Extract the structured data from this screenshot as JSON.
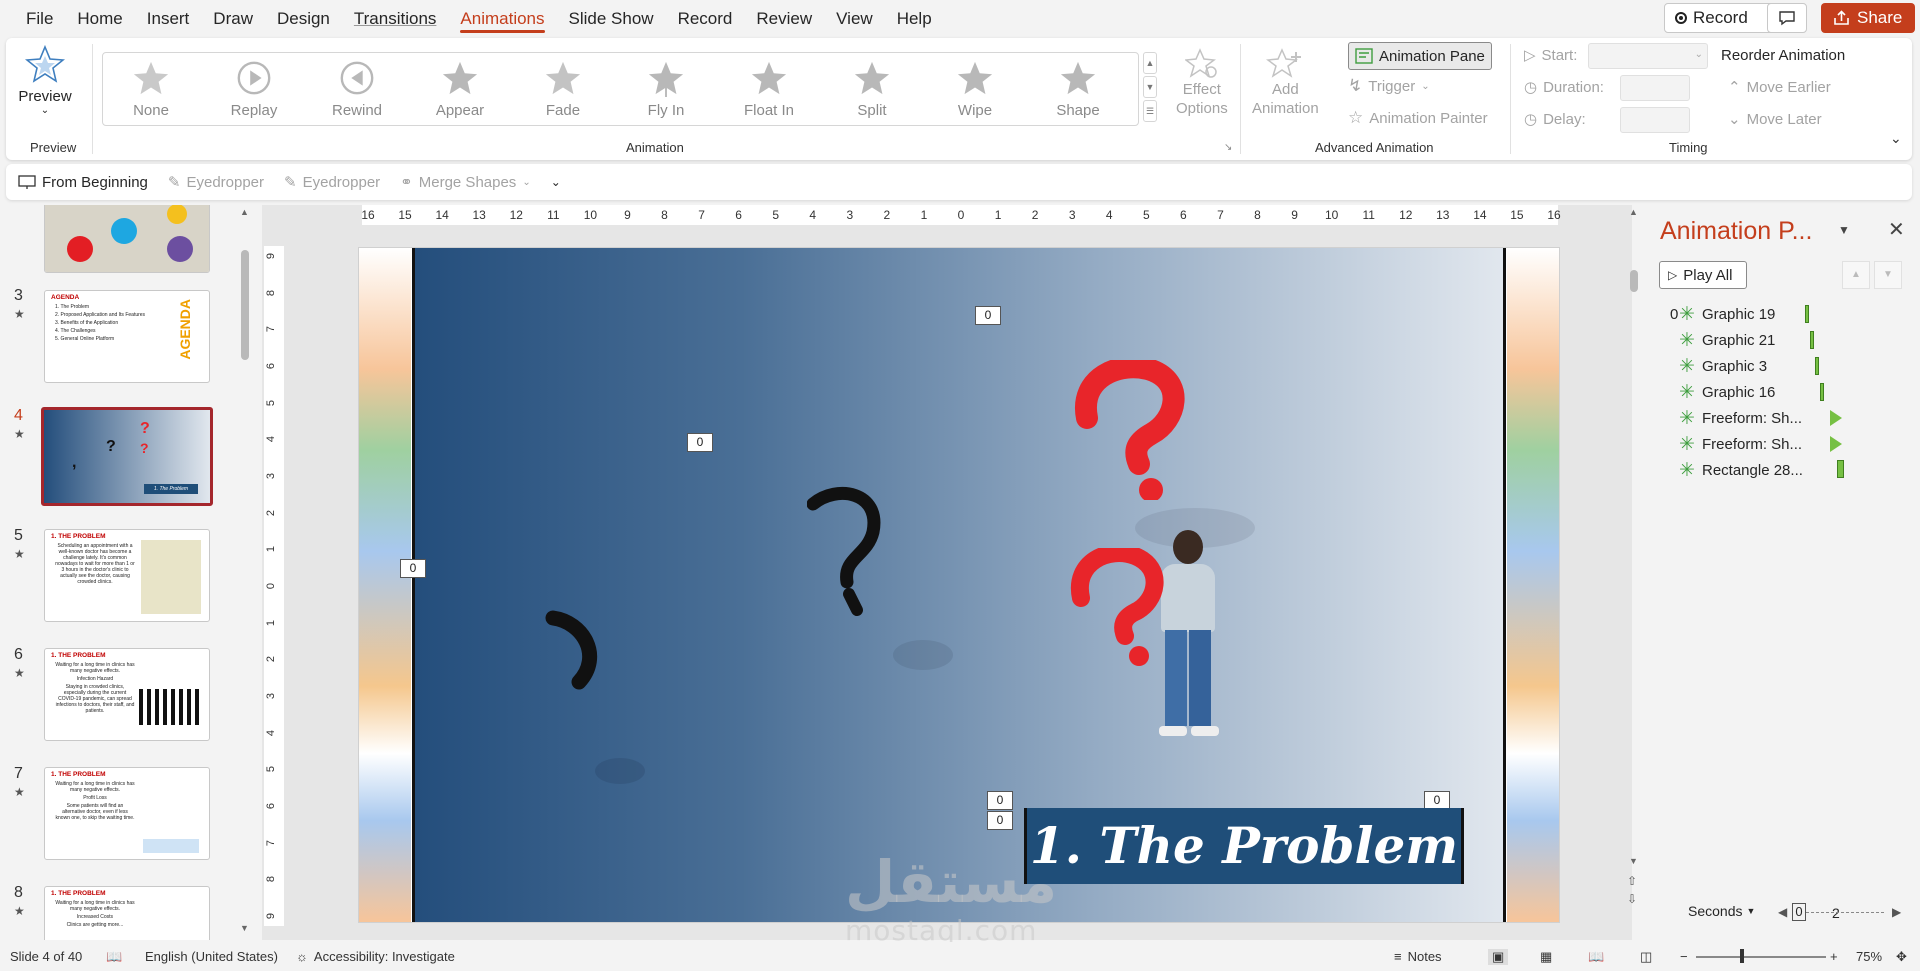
{
  "menu": {
    "tabs": [
      "File",
      "Home",
      "Insert",
      "Draw",
      "Design",
      "Transitions",
      "Animations",
      "Slide Show",
      "Record",
      "Review",
      "View",
      "Help"
    ],
    "active_index": 6,
    "record_label": "Record",
    "share_label": "Share"
  },
  "ribbon": {
    "preview_label": "Preview",
    "preview_group": "Preview",
    "animation_group": "Animation",
    "animations": [
      "None",
      "Replay",
      "Rewind",
      "Appear",
      "Fade",
      "Fly In",
      "Float In",
      "Split",
      "Wipe",
      "Shape"
    ],
    "effect_options_line1": "Effect",
    "effect_options_line2": "Options",
    "add_animation_line1": "Add",
    "add_animation_line2": "Animation",
    "animation_pane_label": "Animation Pane",
    "trigger_label": "Trigger",
    "animation_painter_label": "Animation Painter",
    "advanced_group": "Advanced Animation",
    "start_label": "Start:",
    "duration_label": "Duration:",
    "delay_label": "Delay:",
    "reorder_label": "Reorder Animation",
    "move_earlier_label": "Move Earlier",
    "move_later_label": "Move Later",
    "timing_group": "Timing"
  },
  "qat": {
    "from_beginning": "From Beginning",
    "eyedropper1": "Eyedropper",
    "eyedropper2": "Eyedropper",
    "merge_shapes": "Merge Shapes"
  },
  "thumbnails": [
    {
      "num": "3",
      "title": "AGENDA",
      "lines": [
        "1. The Problem",
        "2. Proposed Application and Its Features",
        "3. Benefits of the Application",
        "4. The Challenges",
        "5. General Online Platform"
      ],
      "side_text": "AGENDA"
    },
    {
      "num": "4",
      "selected": true,
      "caption": "1. The Problem"
    },
    {
      "num": "5",
      "title": "1. THE PROBLEM",
      "lines": [
        "Scheduling an appointment with a well-known doctor has become a challenge lately. It's common nowadays to wait for more than 1 or 3 hours in the doctor's clinic to actually see the doctor, causing crowded clinics."
      ]
    },
    {
      "num": "6",
      "title": "1. THE PROBLEM",
      "lines": [
        "Waiting for a long time in clinics has many negative effects.",
        "Infection Hazard",
        "Staying in crowded clinics, especially during the current COVID-19 pandemic, can spread infections to doctors, their staff, and patients."
      ]
    },
    {
      "num": "7",
      "title": "1. THE PROBLEM",
      "lines": [
        "Waiting for a long time in clinics has many negative effects.",
        "Profit Loss",
        "Some patients will find an alternative doctor, even if less known one, to skip the waiting time."
      ]
    },
    {
      "num": "8",
      "title": "1. THE PROBLEM",
      "lines": [
        "Waiting for a long time in clinics has many negative effects.",
        "Increased Costs",
        "Clinics are getting more..."
      ]
    }
  ],
  "slide": {
    "title": "1. The Problem",
    "tags": [
      "0",
      "0",
      "0",
      "0",
      "0",
      "0"
    ],
    "watermark": "مستقل",
    "watermark_sub": "mostaql.com"
  },
  "ruler": {
    "h_ticks": [
      "16",
      "15",
      "14",
      "13",
      "12",
      "11",
      "10",
      "9",
      "8",
      "7",
      "6",
      "5",
      "4",
      "3",
      "2",
      "1",
      "0",
      "1",
      "2",
      "3",
      "4",
      "5",
      "6",
      "7",
      "8",
      "9",
      "10",
      "11",
      "12",
      "13",
      "14",
      "15",
      "16"
    ],
    "v_ticks": [
      "9",
      "8",
      "7",
      "6",
      "5",
      "4",
      "3",
      "2",
      "1",
      "0",
      "1",
      "2",
      "3",
      "4",
      "5",
      "6",
      "7",
      "8",
      "9"
    ]
  },
  "animation_pane": {
    "title": "Animation P...",
    "play_all": "Play All",
    "first_index": "0",
    "items": [
      {
        "name": "Graphic 19",
        "kind": "bar"
      },
      {
        "name": "Graphic 21",
        "kind": "bar"
      },
      {
        "name": "Graphic 3",
        "kind": "bar"
      },
      {
        "name": "Graphic 16",
        "kind": "bar"
      },
      {
        "name": "Freeform: Sh...",
        "kind": "tri"
      },
      {
        "name": "Freeform: Sh...",
        "kind": "tri"
      },
      {
        "name": "Rectangle 28...",
        "kind": "bar"
      }
    ],
    "seconds_label": "Seconds",
    "timeline_start": "0",
    "timeline_mark": "2"
  },
  "status": {
    "slide_info": "Slide 4 of 40",
    "language": "English (United States)",
    "accessibility": "Accessibility: Investigate",
    "notes": "Notes",
    "zoom": "75%"
  },
  "colors": {
    "accent": "#c43e1c",
    "selected_thumb_border": "#a4262c",
    "banner": "#1f4e79",
    "question_red": "#e8252a",
    "pane_star": "#3f9e3f"
  }
}
